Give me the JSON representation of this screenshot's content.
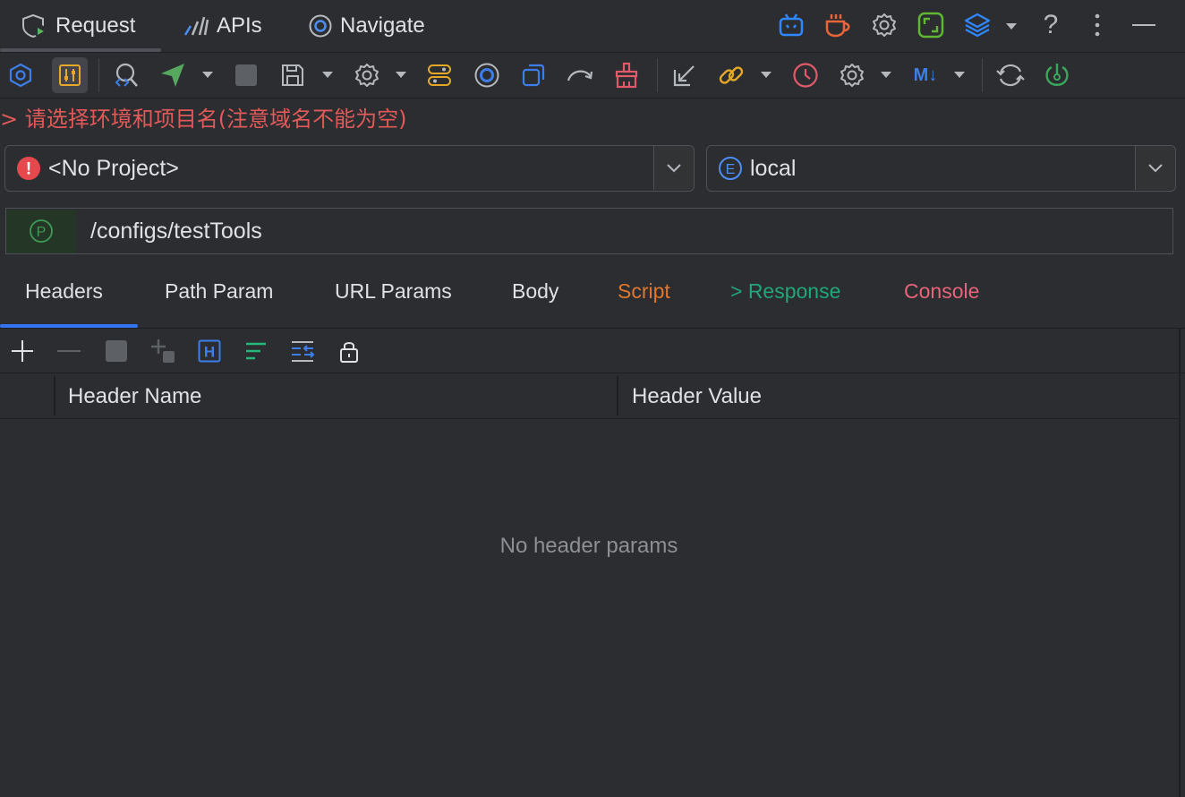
{
  "tabs": [
    {
      "label": "Request",
      "icon": "shield-play-icon"
    },
    {
      "label": "APIs",
      "icon": "apis-chart-icon"
    },
    {
      "label": "Navigate",
      "icon": "navigate-circle-icon"
    }
  ],
  "right_icons": [
    "bilibili-tv-icon",
    "coffee-icon",
    "settings-gear-icon",
    "screen-capture-icon",
    "layers-icon",
    "help-icon",
    "more-vertical-icon",
    "minimize-icon"
  ],
  "help_label": "?",
  "toolbar_icons": [
    "hexagon-icon",
    "sliders-icon",
    "search-code-icon",
    "send-icon",
    "stop-icon",
    "save-icon",
    "gear-icon",
    "toggle-icon",
    "record-icon",
    "copy-icon",
    "redo-icon",
    "clean-broom-icon",
    "import-icon",
    "link-icon",
    "history-clock-icon",
    "config-gear-icon",
    "markdown-icon",
    "sync-icon",
    "power-icon"
  ],
  "markdown_label": "M↓",
  "warning": "> 请选择环境和项目名(注意域名不能为空)",
  "project_select": {
    "value": "<No Project>",
    "icon": "error-icon",
    "icon_glyph": "!"
  },
  "env_select": {
    "value": "local",
    "icon": "environment-icon",
    "icon_glyph": "E"
  },
  "path": {
    "value": "/configs/testTools",
    "icon": "p-circle-icon",
    "icon_glyph": "P"
  },
  "subtabs": [
    {
      "label": "Headers",
      "color": "#dfe1e5"
    },
    {
      "label": "Path Param",
      "color": "#dfe1e5"
    },
    {
      "label": "URL Params",
      "color": "#dfe1e5"
    },
    {
      "label": "Body",
      "color": "#dfe1e5"
    },
    {
      "label": "Script",
      "color": "#e0772e"
    },
    {
      "label": "> Response",
      "color": "#21a67a"
    },
    {
      "label": "Console",
      "color": "#e8647a"
    }
  ],
  "table_toolbar": [
    "add-icon",
    "remove-icon",
    "stop-square-icon",
    "add-copy-icon",
    "h-icon",
    "align-icon",
    "compare-icon",
    "lock-icon"
  ],
  "h_label": "H",
  "table": {
    "columns": [
      "Header Name",
      "Header Value"
    ],
    "rows": [],
    "empty_text": "No header params"
  },
  "colors": {
    "accent": "#3574f0",
    "error": "#e05a5a",
    "background": "#2b2d30"
  }
}
